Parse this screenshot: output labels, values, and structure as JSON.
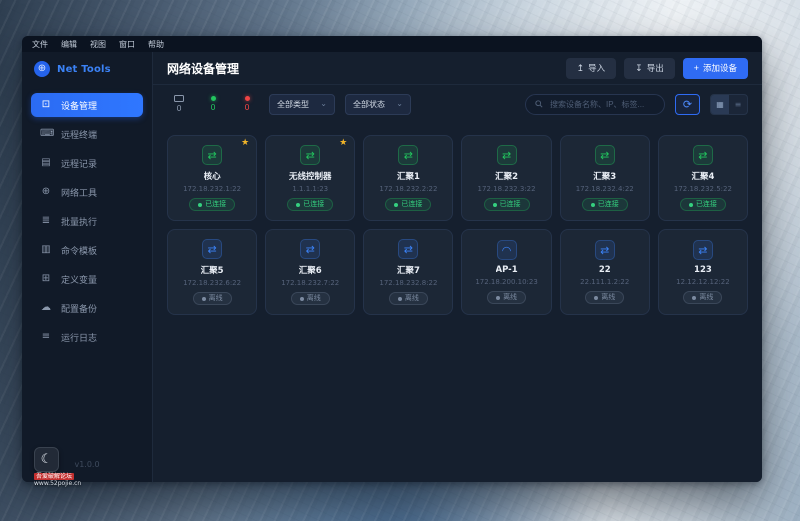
{
  "menu_bar": {
    "items": [
      {
        "label": "文件"
      },
      {
        "label": "编辑"
      },
      {
        "label": "视图"
      },
      {
        "label": "窗口"
      },
      {
        "label": "帮助"
      }
    ]
  },
  "sidebar": {
    "brand": "Net Tools",
    "items": [
      {
        "label": "设备管理",
        "icon": "device-monitor",
        "active": true
      },
      {
        "label": "远程终端",
        "icon": "terminal"
      },
      {
        "label": "远程记录",
        "icon": "clipboard"
      },
      {
        "label": "网络工具",
        "icon": "globe"
      },
      {
        "label": "批量执行",
        "icon": "batch-list"
      },
      {
        "label": "命令模板",
        "icon": "template-doc"
      },
      {
        "label": "定义变量",
        "icon": "plus-square"
      },
      {
        "label": "配置备份",
        "icon": "cloud"
      },
      {
        "label": "运行日志",
        "icon": "log"
      }
    ],
    "version": "v1.0.0"
  },
  "header": {
    "title": "网络设备管理",
    "import_label": "导入",
    "export_label": "导出",
    "add_device_label": "添加设备"
  },
  "toolbar": {
    "stats": {
      "total": "0",
      "online": "0",
      "offline": "0"
    },
    "type_filter": "全部类型",
    "status_filter": "全部状态",
    "search_placeholder": "搜索设备名称、IP、标签..."
  },
  "status_labels": {
    "connected": "已连接",
    "offline": "离线"
  },
  "devices": [
    {
      "name": "核心",
      "address": "172.18.232.1:22",
      "status": "connected",
      "icon": "switch",
      "starred": true
    },
    {
      "name": "无线控制器",
      "address": "1.1.1.1:23",
      "status": "connected",
      "icon": "switch",
      "starred": true
    },
    {
      "name": "汇聚1",
      "address": "172.18.232.2:22",
      "status": "connected",
      "icon": "switch",
      "starred": false
    },
    {
      "name": "汇聚2",
      "address": "172.18.232.3:22",
      "status": "connected",
      "icon": "switch",
      "starred": false
    },
    {
      "name": "汇聚3",
      "address": "172.18.232.4:22",
      "status": "connected",
      "icon": "switch",
      "starred": false
    },
    {
      "name": "汇聚4",
      "address": "172.18.232.5:22",
      "status": "connected",
      "icon": "switch",
      "starred": false
    },
    {
      "name": "汇聚5",
      "address": "172.18.232.6:22",
      "status": "offline",
      "icon": "switch",
      "starred": false
    },
    {
      "name": "汇聚6",
      "address": "172.18.232.7:22",
      "status": "offline",
      "icon": "switch",
      "starred": false
    },
    {
      "name": "汇聚7",
      "address": "172.18.232.8:22",
      "status": "offline",
      "icon": "switch",
      "starred": false
    },
    {
      "name": "AP-1",
      "address": "172.18.200.10:23",
      "status": "offline",
      "icon": "wifi",
      "starred": false
    },
    {
      "name": "22",
      "address": "22.111.1.2:22",
      "status": "offline",
      "icon": "switch",
      "starred": false
    },
    {
      "name": "123",
      "address": "12.12.12.12:22",
      "status": "offline",
      "icon": "switch",
      "starred": false
    }
  ],
  "watermark": {
    "line1": "吾爱破解论坛",
    "line2": "www.52pojie.cn"
  },
  "icon_glyphs": {
    "device-monitor": "⊡",
    "terminal": "⌨",
    "clipboard": "▤",
    "globe": "⊕",
    "batch-list": "≣",
    "template-doc": "▥",
    "plus-square": "⊞",
    "cloud": "☁",
    "log": "≡",
    "switch": "⇄",
    "wifi": "◠",
    "import": "↥",
    "export": "↧",
    "plus": "+",
    "refresh": "⟳",
    "grid-view": "▦",
    "list-view": "≡",
    "chevron-down": "⌄",
    "star": "★",
    "brand-globe": "⊕",
    "moon": "☾"
  },
  "colors": {
    "accent_blue": "#2f6bf3",
    "online_green": "#22c55e",
    "offline_red": "#ef4444",
    "star_gold": "#f0b429",
    "window_bg": "#16202f",
    "sidebar_bg": "#111a28",
    "card_bg": "#1c2736"
  }
}
